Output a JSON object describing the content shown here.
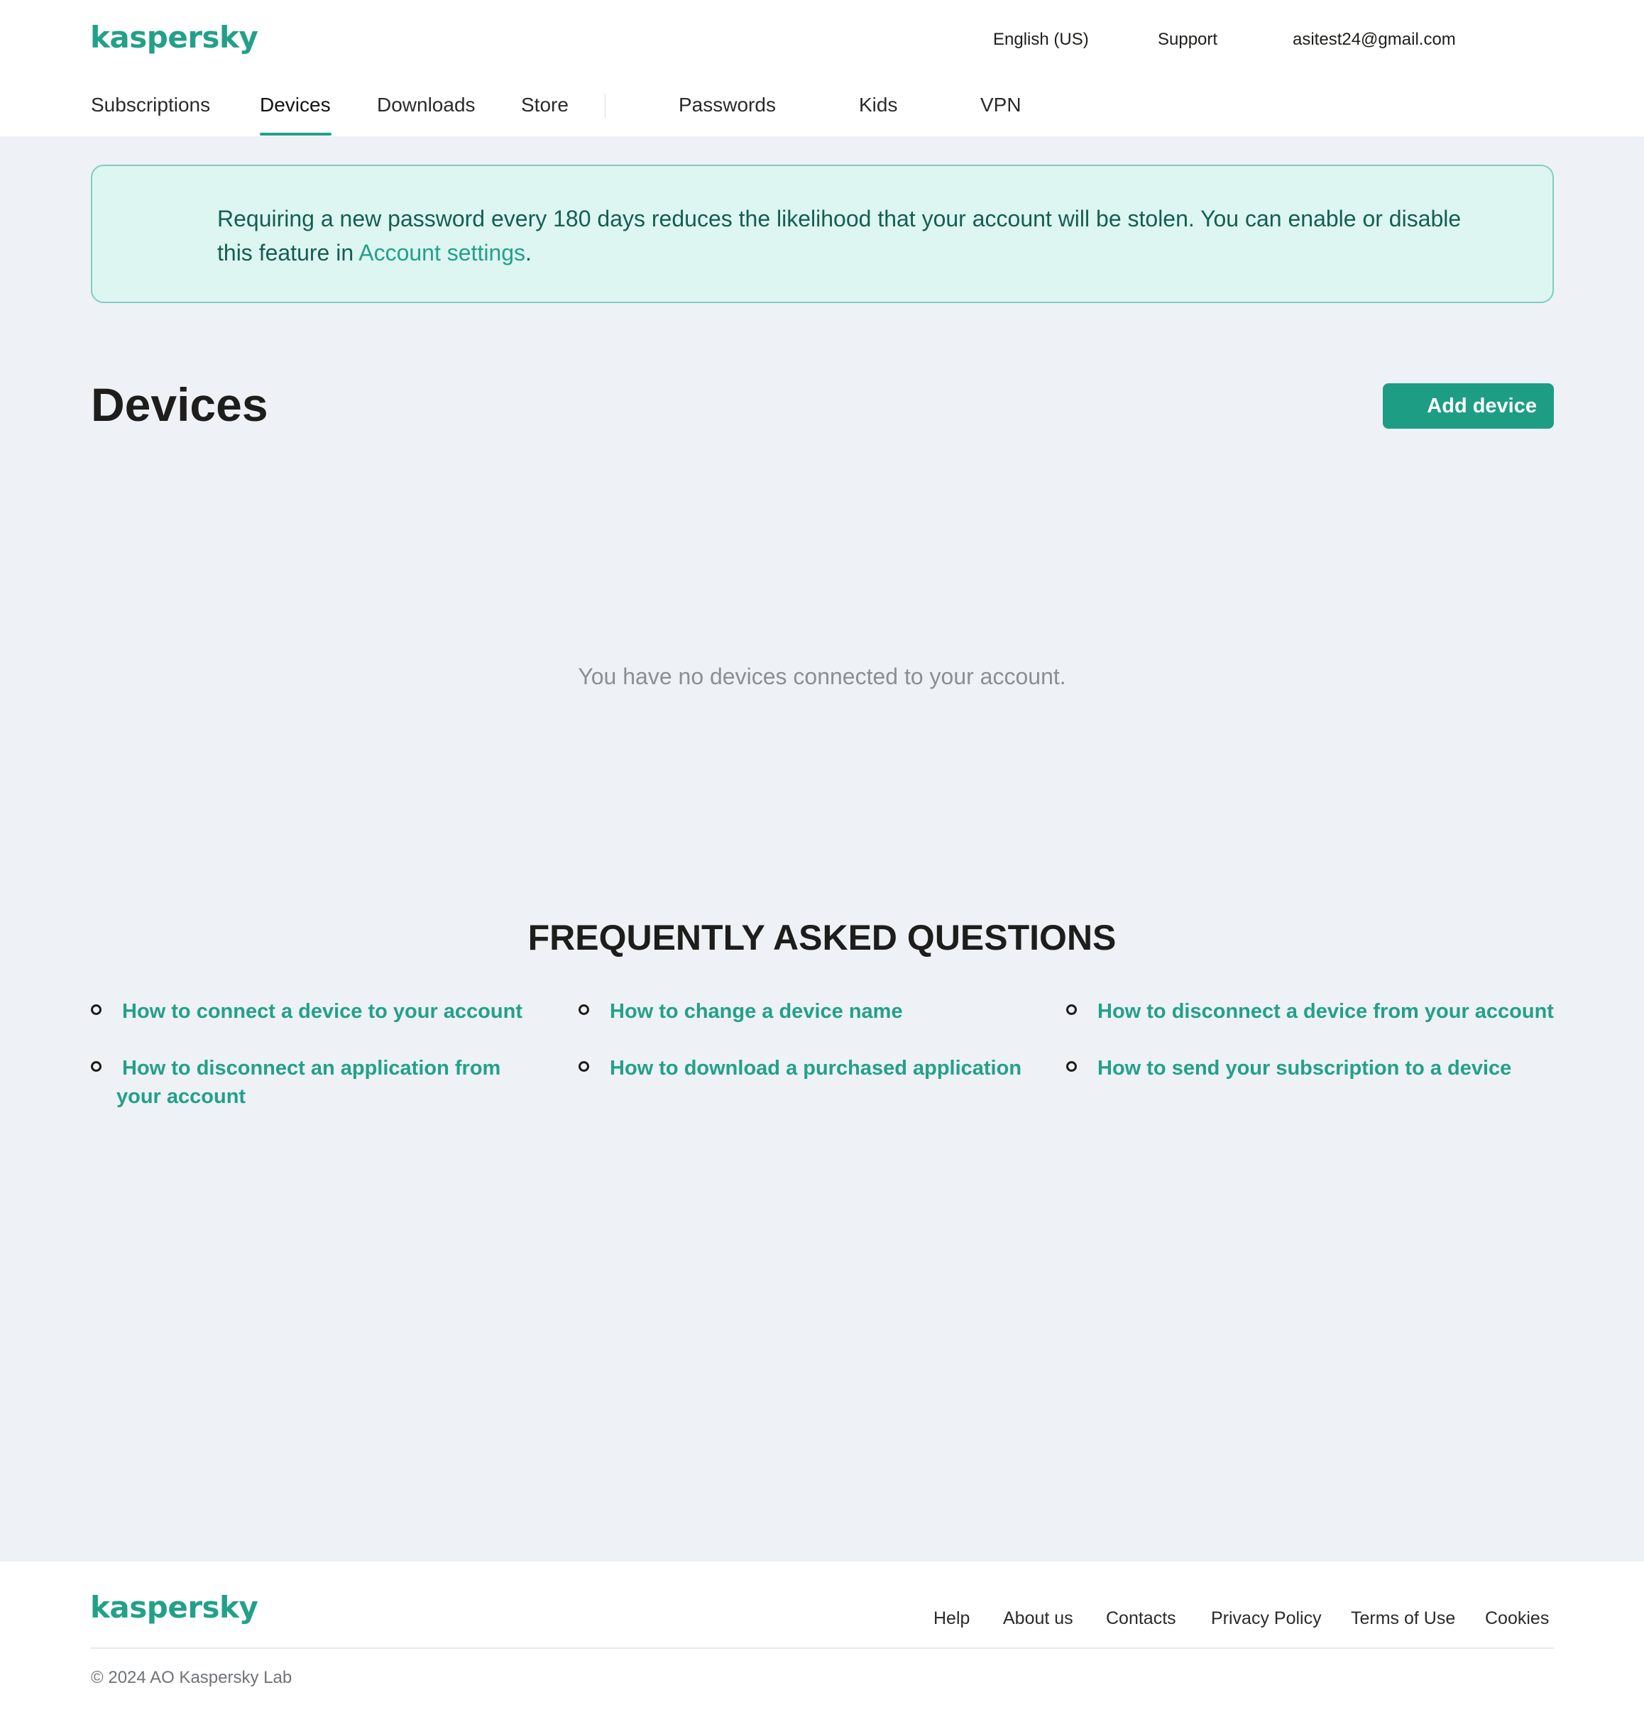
{
  "header": {
    "logo": "kaspersky",
    "language": "English (US)",
    "support": "Support",
    "account_email": "asitest24@gmail.com"
  },
  "nav": {
    "subscriptions": "Subscriptions",
    "devices": "Devices",
    "downloads": "Downloads",
    "store": "Store",
    "passwords": "Passwords",
    "kids": "Kids",
    "vpn": "VPN",
    "active": "Devices"
  },
  "notice": {
    "text_before": "Requiring a new password every 180 days reduces the likelihood that your account will be stolen. You can enable or disable this feature in ",
    "link": "Account settings",
    "text_after": "."
  },
  "main": {
    "title": "Devices",
    "add_button": "Add device",
    "empty_message": "You have no devices connected to your account."
  },
  "faq": {
    "title": "FREQUENTLY ASKED QUESTIONS",
    "items": [
      "How to connect a device to your account",
      "How to change a device name",
      "How to disconnect a device from your account",
      "How to disconnect an application from your account",
      "How to download a purchased application",
      "How to send your subscription to a device"
    ]
  },
  "footer": {
    "logo": "kaspersky",
    "links": [
      "Help",
      "About us",
      "Contacts",
      "Privacy Policy",
      "Terms of Use",
      "Cookies"
    ],
    "copyright": "© 2024 AO Kaspersky Lab"
  },
  "colors": {
    "accent": "#23a08a",
    "button": "#1d9e84",
    "notice_bg": "#ddf6f1",
    "page_bg": "#eef1f5"
  }
}
